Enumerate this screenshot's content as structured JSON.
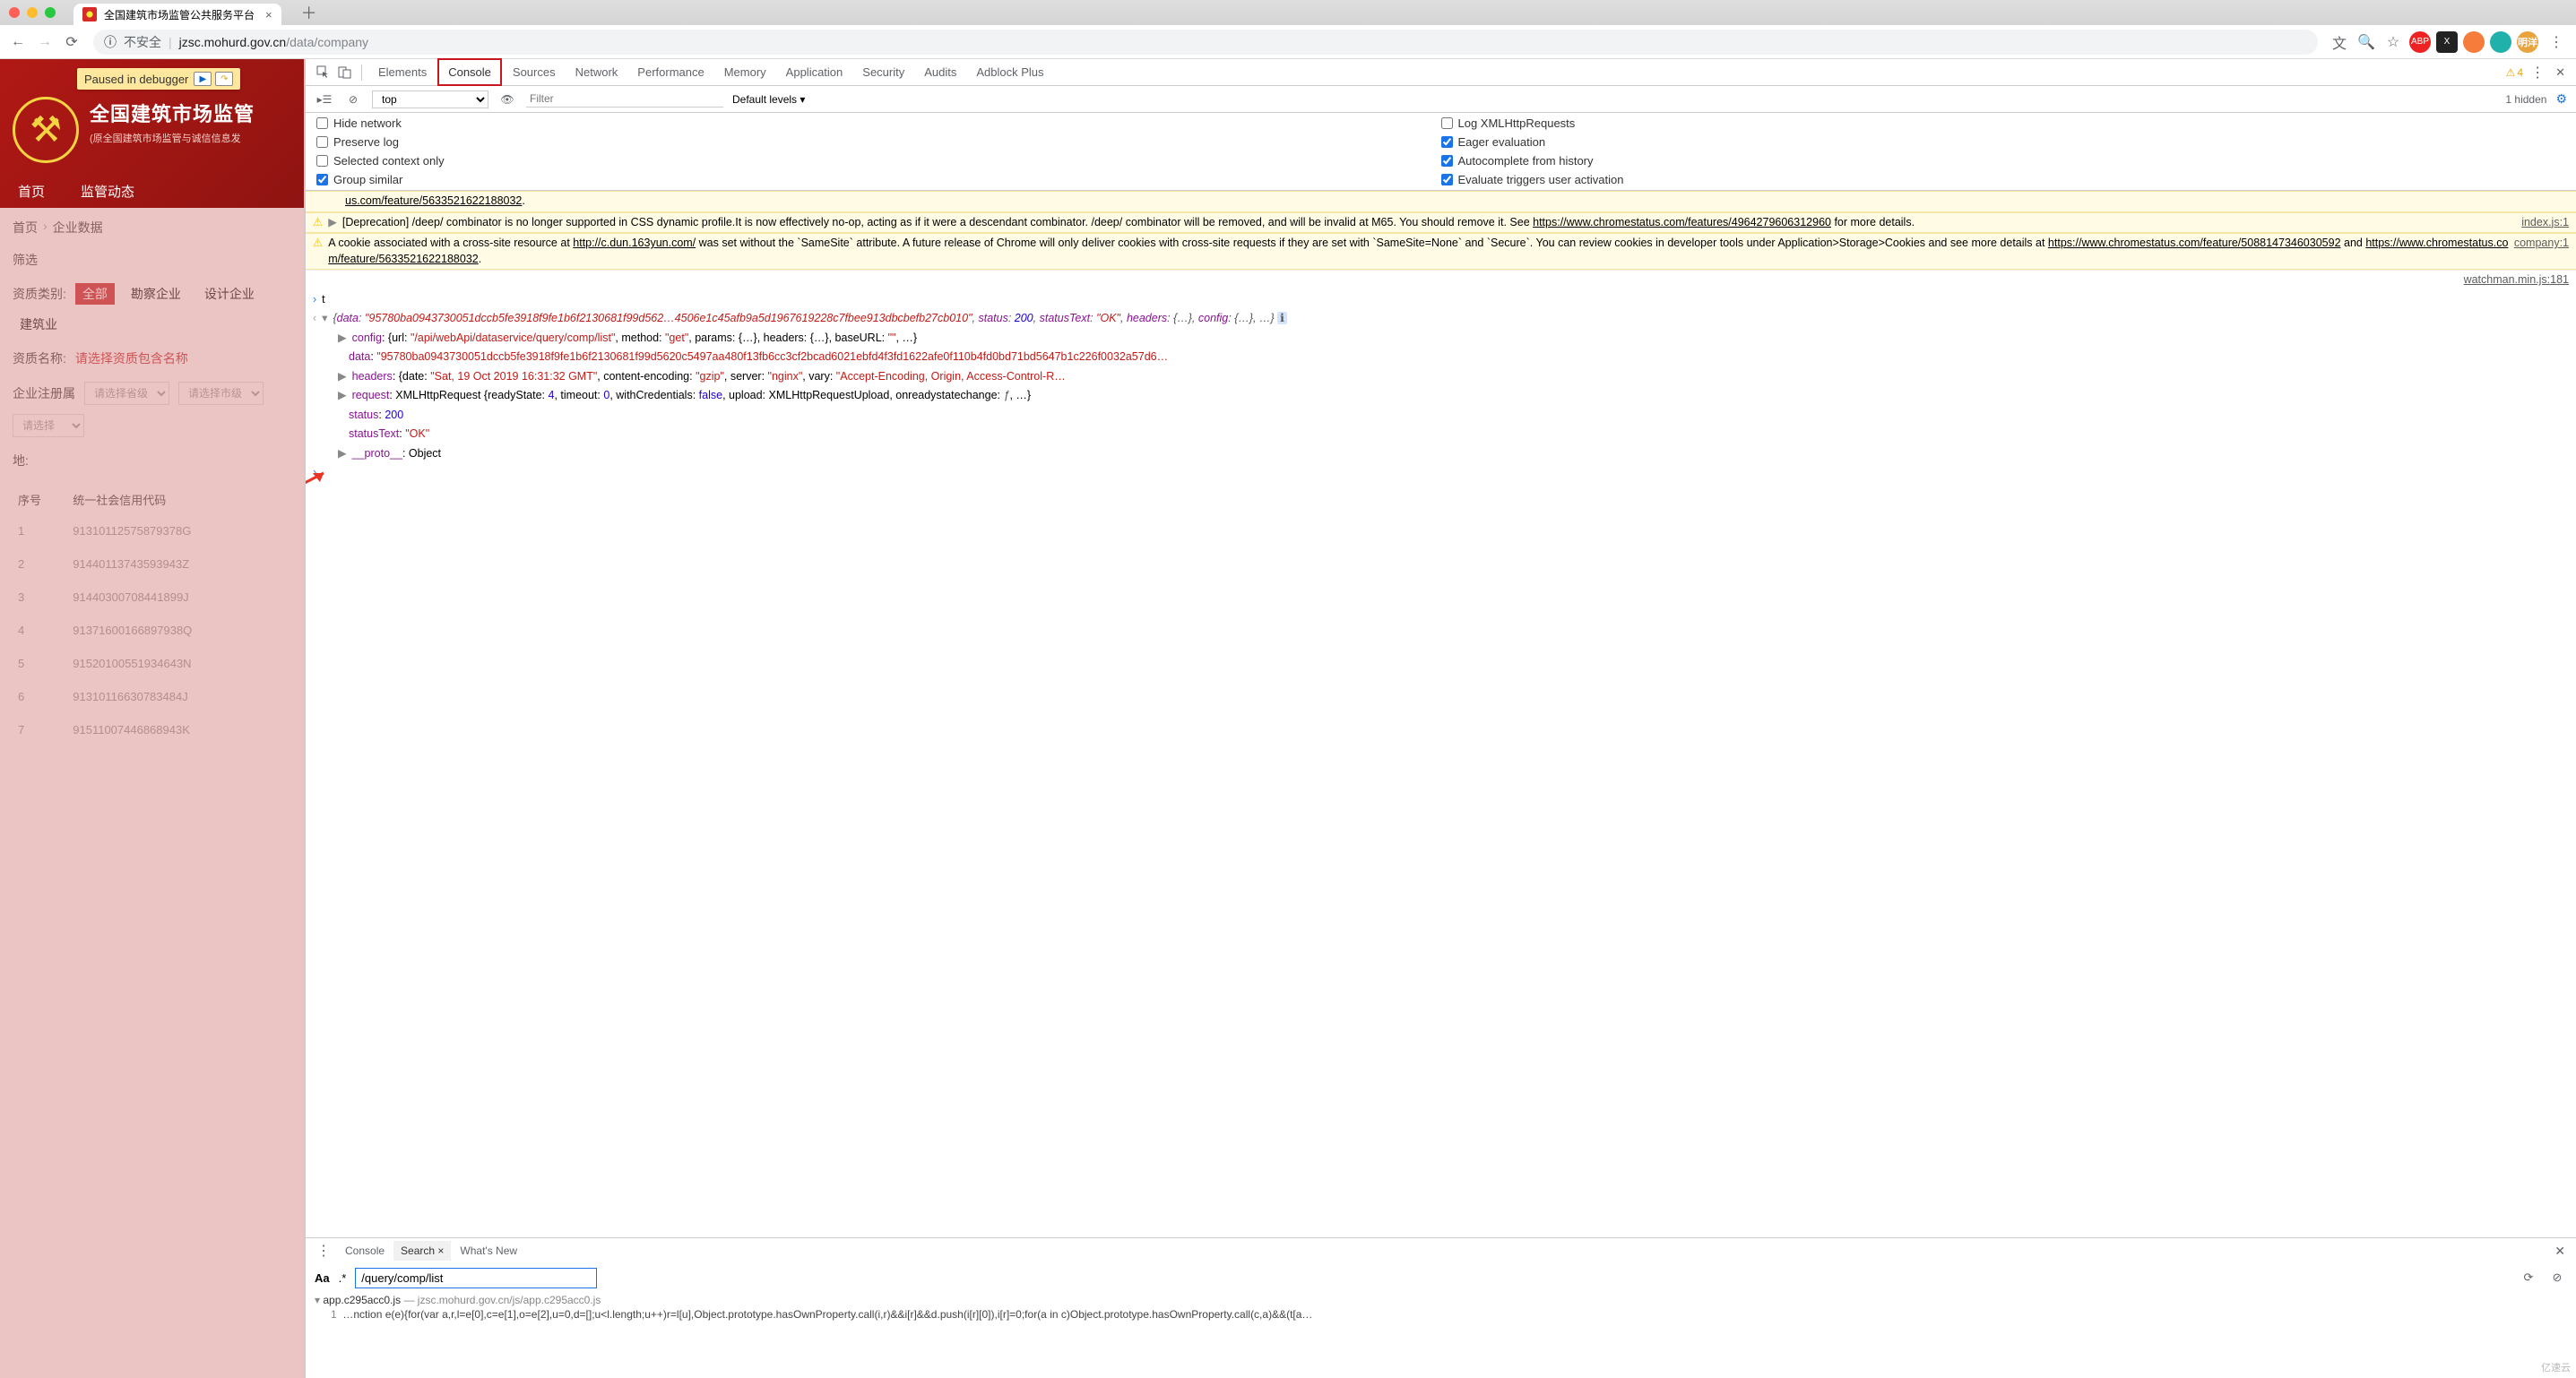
{
  "window": {
    "tab_title": "全国建筑市场监管公共服务平台",
    "url_warn": "不安全",
    "url_host": "jzsc.mohurd.gov.cn",
    "url_path": "/data/company"
  },
  "ext": {
    "translate": "文",
    "abp": "ABP",
    "x": "X"
  },
  "page": {
    "debug_pill": "Paused in debugger",
    "hero_title": "全国建筑市场监管",
    "hero_sub": "(原全国建筑市场监管与诚信信息发",
    "nav1": "首页",
    "nav2": "监管动态",
    "bc1": "首页",
    "bc2": "企业数据",
    "filter_title": "筛选",
    "lbl_type": "资质类别:",
    "tag_all": "全部",
    "tag_survey": "勘察企业",
    "tag_design": "设计企业",
    "tag_build": "建筑业",
    "lbl_name": "资质名称:",
    "name_ph": "请选择资质包含名称",
    "lbl_reg": "企业注册属",
    "sel_prov": "请选择省级",
    "sel_city": "请选择市级",
    "sel_other": "请选择",
    "lbl_addr": "地:",
    "th_idx": "序号",
    "th_code": "统一社会信用代码",
    "rows": [
      {
        "i": "1",
        "c": "91310112575879378G"
      },
      {
        "i": "2",
        "c": "91440113743593943Z"
      },
      {
        "i": "3",
        "c": "91440300708441899J"
      },
      {
        "i": "4",
        "c": "91371600166897938Q"
      },
      {
        "i": "5",
        "c": "91520100551934643N"
      },
      {
        "i": "6",
        "c": "91310116630783484J"
      },
      {
        "i": "7",
        "c": "91511007446868943K"
      }
    ]
  },
  "dt": {
    "tabs": {
      "elements": "Elements",
      "console": "Console",
      "sources": "Sources",
      "network": "Network",
      "performance": "Performance",
      "memory": "Memory",
      "application": "Application",
      "security": "Security",
      "audits": "Audits",
      "adblock": "Adblock Plus"
    },
    "warn_count": "4",
    "context": "top",
    "filter_ph": "Filter",
    "levels": "Default levels ▾",
    "hidden": "1 hidden",
    "opts": {
      "hide_net": "Hide network",
      "preserve": "Preserve log",
      "sel_ctx": "Selected context only",
      "group": "Group similar",
      "xhr": "Log XMLHttpRequests",
      "eager": "Eager evaluation",
      "auto": "Autocomplete from history",
      "eval": "Evaluate triggers user activation"
    }
  },
  "console": {
    "w1_pre": "us.com/feature/5633521622188032",
    "w1_src": "index.js:1",
    "w1": "[Deprecation] /deep/ combinator is no longer supported in CSS dynamic profile.It is now effectively no-op, acting as if it were a descendant combinator. /deep/ combinator will be removed, and will be invalid at M65. You should remove it. See ",
    "w1_link": "https://www.chromestatus.com/features/4964279606312960",
    "w1_post": " for more details.",
    "w2_a": "A cookie associated with a cross-site resource at ",
    "w2_url": "http://c.dun.163yun.com/",
    "w2_b": " was set without the `SameSite` attribute. A future release of Chrome will only deliver cookies with cross-site requests if they are set with `SameSite=None` and `Secure`. You can review cookies in developer tools under Application>Storage>Cookies and see more details at ",
    "w2_link1": "https://www.chromestatus.com/feature/5088147346030592",
    "w2_and": " and ",
    "w2_link2": "https://www.chromestatus.com/feature/5633521622188032",
    "w2_src": "company:1",
    "w3_src": "watchman.min.js:181",
    "t": "t",
    "obj": {
      "data_short": "\"95780ba0943730051dccb5fe3918f9fe1b6f2130681f99d562…4506e1c45afb9a5d1967619228c7fbee913dbcbefb27cb010\"",
      "status": "200",
      "statusText": "\"OK\"",
      "config_url": "\"/api/webApi/dataservice/query/comp/list\"",
      "config_method": "\"get\"",
      "config_baseURL": "\"\"",
      "data_long": "\"95780ba0943730051dccb5fe3918f9fe1b6f2130681f99d5620c5497aa480f13fb6cc3cf2bcad6021ebfd4f3fd1622afe0f110b4fd0bd71bd5647b1c226f0032a57d6…",
      "hdr_date": "\"Sat, 19 Oct 2019 16:31:32 GMT\"",
      "hdr_enc": "\"gzip\"",
      "hdr_srv": "\"nginx\"",
      "hdr_vary": "\"Accept-Encoding, Origin, Access-Control-R…",
      "req_rs": "4",
      "req_to": "0",
      "req_wc": "false",
      "req_up": "XMLHttpRequestUpload",
      "req_orc": "ƒ",
      "proto": "Object"
    }
  },
  "drawer": {
    "tabs": {
      "console": "Console",
      "search": "Search",
      "whatsnew": "What's New"
    },
    "case": "Aa",
    "regex": ".*",
    "query": "/query/comp/list",
    "file": "app.c295acc0.js",
    "file_src": "jzsc.mohurd.gov.cn/js/app.c295acc0.js",
    "line_no": "1",
    "line": "…nction e(e){for(var a,r,l=e[0],c=e[1],o=e[2],u=0,d=[];u<l.length;u++)r=l[u],Object.prototype.hasOwnProperty.call(i,r)&&i[r]&&d.push(i[r][0]),i[r]=0;for(a in c)Object.prototype.hasOwnProperty.call(c,a)&&(t[a…"
  },
  "watermark": "亿速云"
}
